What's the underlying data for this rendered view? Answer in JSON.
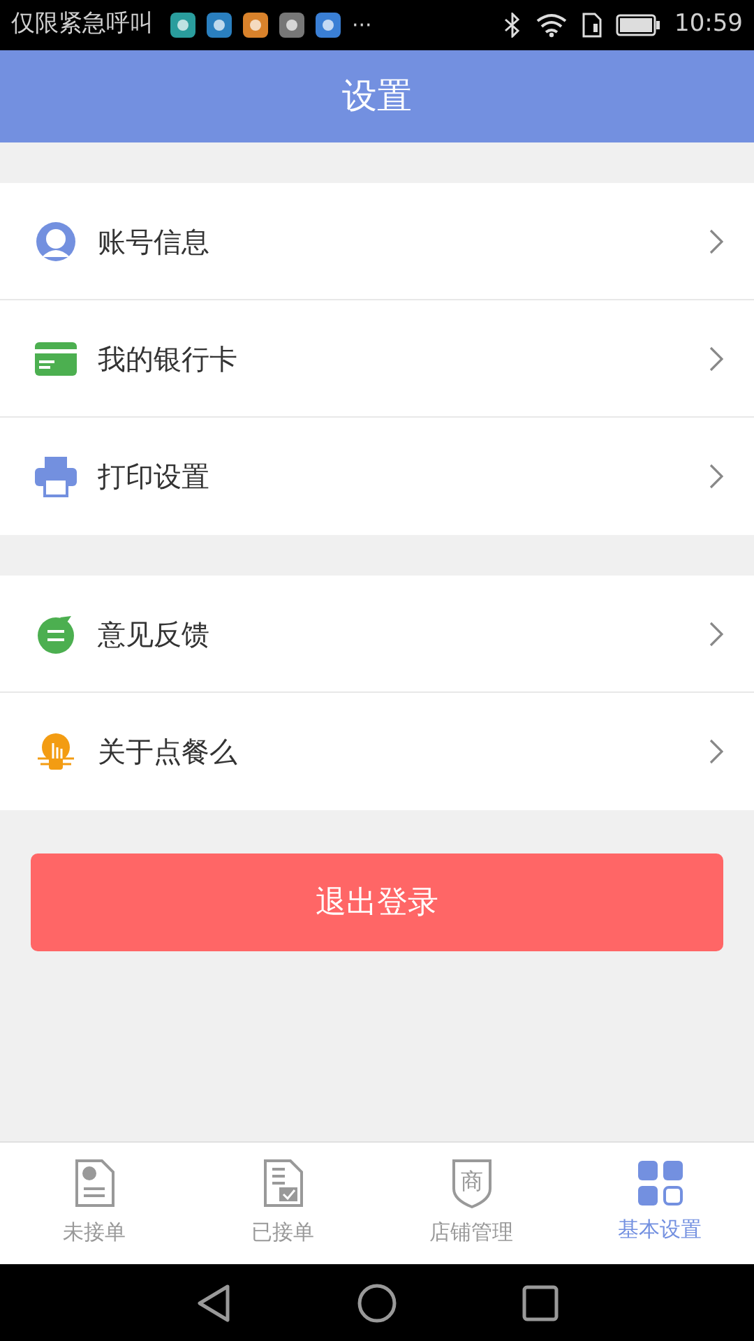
{
  "status_bar": {
    "carrier": "仅限紧急呼叫",
    "more": "···",
    "time": "10:59"
  },
  "header": {
    "title": "设置"
  },
  "groups": [
    {
      "items": [
        {
          "kind": "account",
          "label": "账号信息"
        },
        {
          "kind": "card",
          "label": "我的银行卡"
        },
        {
          "kind": "printer",
          "label": "打印设置"
        }
      ]
    },
    {
      "items": [
        {
          "kind": "feedback",
          "label": "意见反馈"
        },
        {
          "kind": "about",
          "label": "关于点餐么"
        }
      ]
    }
  ],
  "logout_button": "退出登录",
  "tabs": [
    {
      "kind": "pending",
      "label": "未接单",
      "selected": false
    },
    {
      "kind": "accepted",
      "label": "已接单",
      "selected": false
    },
    {
      "kind": "shop",
      "label": "店铺管理",
      "glyph": "商",
      "selected": false
    },
    {
      "kind": "settings",
      "label": "基本设置",
      "selected": true
    }
  ]
}
